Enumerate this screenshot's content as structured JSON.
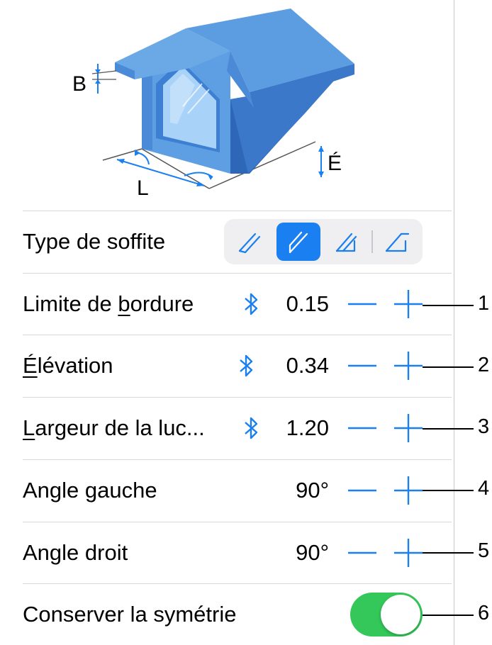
{
  "illustration": {
    "labels": {
      "b": "B",
      "l": "L",
      "e": "É"
    }
  },
  "soffit": {
    "label": "Type de soffite",
    "options": [
      "soffit-type-1-icon",
      "soffit-type-2-icon",
      "soffit-type-3-icon",
      "soffit-type-4-icon"
    ],
    "selected_index": 1
  },
  "rows": [
    {
      "label": "Limite de ",
      "label_ul": "b",
      "label_rest": "ordure",
      "bluetooth": true,
      "value": "0.15"
    },
    {
      "label_ul": "É",
      "label_rest": "lévation",
      "bluetooth": true,
      "value": "0.34"
    },
    {
      "label_ul": "L",
      "label_rest": "argeur de la luc...",
      "bluetooth": true,
      "value": "1.20"
    },
    {
      "label": "Angle gauche",
      "bluetooth": false,
      "value": "90°"
    },
    {
      "label": "Angle droit",
      "bluetooth": false,
      "value": "90°"
    }
  ],
  "symmetry": {
    "label": "Conserver la symétrie",
    "on": true
  },
  "callouts": [
    "1",
    "2",
    "3",
    "4",
    "5",
    "6"
  ],
  "colors": {
    "accent": "#1a7ff0",
    "toggle_on": "#34c759",
    "roof": "#5b9de0"
  }
}
